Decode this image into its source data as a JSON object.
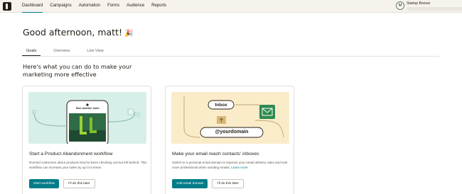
{
  "nav": {
    "items": [
      {
        "label": "Dashboard",
        "active": true
      },
      {
        "label": "Campaigns",
        "active": false
      },
      {
        "label": "Automation",
        "active": false
      },
      {
        "label": "Forms",
        "active": false
      },
      {
        "label": "Audience",
        "active": false
      },
      {
        "label": "Reports",
        "active": false
      }
    ]
  },
  "account": {
    "avatar_letter": "M",
    "name": "Startup Bonsai"
  },
  "greeting": {
    "text": "Good afternoon, matt!",
    "emoji": "🎉"
  },
  "tabs": [
    {
      "label": "Goals",
      "active": true
    },
    {
      "label": "Overview",
      "active": false
    },
    {
      "label": "Live View",
      "active": false
    }
  ],
  "section_title": "Here's what you can do to make your marketing more effective",
  "cards": [
    {
      "illustration": {
        "phone_text": "Take another look!"
      },
      "title": "Start a Product Abandonment workflow",
      "description": "Remind customers about products they've been checking out but left behind. This workflow can increase your sales by up to 5 times.",
      "primary_button": "Start workflow",
      "secondary_button": "I'll do this later"
    },
    {
      "illustration": {
        "inbox_label": "Inbox",
        "domain_label": "@yourdomain"
      },
      "title": "Make your email reach contacts' inboxes",
      "description": "Switch to a personal email domain to improve your email delivery rates and look more professional when sending emails.",
      "link_text": "Learn more",
      "primary_button": "Add email domain",
      "secondary_button": "I'll do this later"
    }
  ],
  "colors": {
    "accent": "#007c89",
    "topbar": "#f6f2ec",
    "illus_green": "#d7efe9",
    "illus_yellow": "#fbecc9"
  }
}
